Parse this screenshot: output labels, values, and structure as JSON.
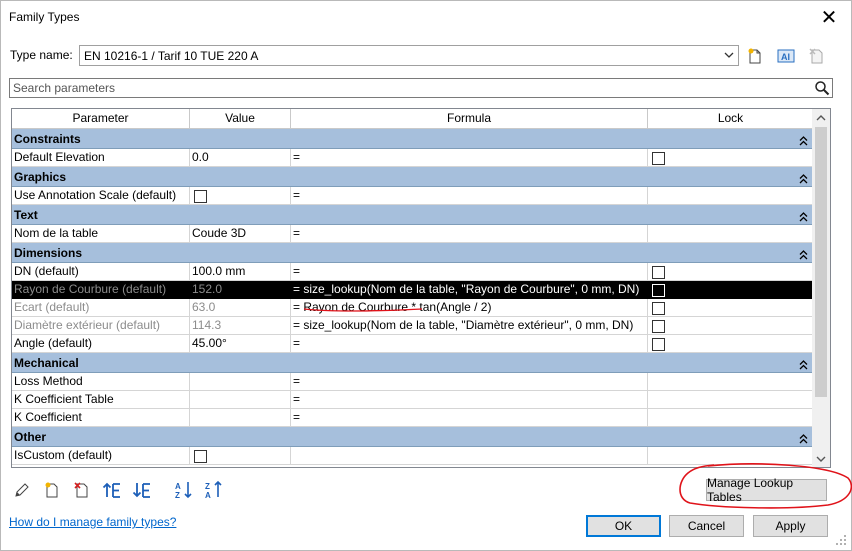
{
  "window": {
    "title": "Family Types",
    "close_glyph": "✕"
  },
  "type_name": {
    "label": "Type name:",
    "value": "EN 10216-1 / Tarif 10 TUE 220 A"
  },
  "toolbar_icons": [
    "new-type-icon",
    "rename-type-icon",
    "delete-type-icon"
  ],
  "search": {
    "placeholder": "Search parameters"
  },
  "columns": {
    "parameter": "Parameter",
    "value": "Value",
    "formula": "Formula",
    "lock": "Lock"
  },
  "groups": [
    {
      "name": "Constraints",
      "params": [
        {
          "name": "Default Elevation",
          "value": "0.0",
          "formula": "=",
          "lock": true,
          "grey": false,
          "value_checkbox": false
        }
      ]
    },
    {
      "name": "Graphics",
      "params": [
        {
          "name": "Use Annotation Scale (default)",
          "value": "",
          "formula": "=",
          "lock": false,
          "grey": false,
          "value_checkbox": true
        }
      ]
    },
    {
      "name": "Text",
      "params": [
        {
          "name": "Nom de la table",
          "value": "Coude 3D",
          "formula": "=",
          "lock": false,
          "grey": false,
          "value_checkbox": false
        }
      ]
    },
    {
      "name": "Dimensions",
      "params": [
        {
          "name": "DN (default)",
          "value": "100.0 mm",
          "formula": "=",
          "lock": true,
          "grey": false,
          "value_checkbox": false
        },
        {
          "name": "Rayon de Courbure (default)",
          "value": "152.0",
          "formula": "= size_lookup(Nom de la table, \"Rayon de Courbure\", 0 mm, DN)",
          "lock": true,
          "grey": true,
          "value_checkbox": false,
          "selected": true
        },
        {
          "name": "Ecart (default)",
          "value": "63.0",
          "formula": "= Rayon de Courbure * tan(Angle / 2)",
          "lock": true,
          "grey": true,
          "value_checkbox": false
        },
        {
          "name": "Diamètre extérieur (default)",
          "value": "114.3",
          "formula": "= size_lookup(Nom de la table, \"Diamètre extérieur\", 0 mm, DN)",
          "lock": true,
          "grey": true,
          "value_checkbox": false
        },
        {
          "name": "Angle (default)",
          "value": "45.00°",
          "formula": "=",
          "lock": true,
          "grey": false,
          "value_checkbox": false
        }
      ]
    },
    {
      "name": "Mechanical",
      "params": [
        {
          "name": "Loss Method",
          "value": "",
          "formula": "=",
          "lock": false,
          "grey": false,
          "value_checkbox": false
        },
        {
          "name": "K Coefficient Table",
          "value": "",
          "formula": "=",
          "lock": false,
          "grey": false,
          "value_checkbox": false
        },
        {
          "name": "K Coefficient",
          "value": "",
          "formula": "=",
          "lock": false,
          "grey": false,
          "value_checkbox": false
        }
      ]
    },
    {
      "name": "Other",
      "params": [
        {
          "name": "IsCustom (default)",
          "value": "",
          "formula": "",
          "lock": false,
          "grey": false,
          "value_checkbox": true
        }
      ]
    }
  ],
  "bottom_icons": [
    "edit-parameter-icon",
    "new-parameter-icon",
    "delete-parameter-icon",
    "move-up-icon",
    "move-down-icon",
    "sort-ascending-icon",
    "sort-descending-icon"
  ],
  "buttons": {
    "manage_lookup": "Manage Lookup Tables",
    "ok": "OK",
    "cancel": "Cancel",
    "apply": "Apply"
  },
  "help_link": "How do I manage family types?",
  "colors": {
    "group_header": "#a6bfdc",
    "selection": "#000000",
    "annotation": "#e0131a",
    "link": "#0066cc"
  }
}
